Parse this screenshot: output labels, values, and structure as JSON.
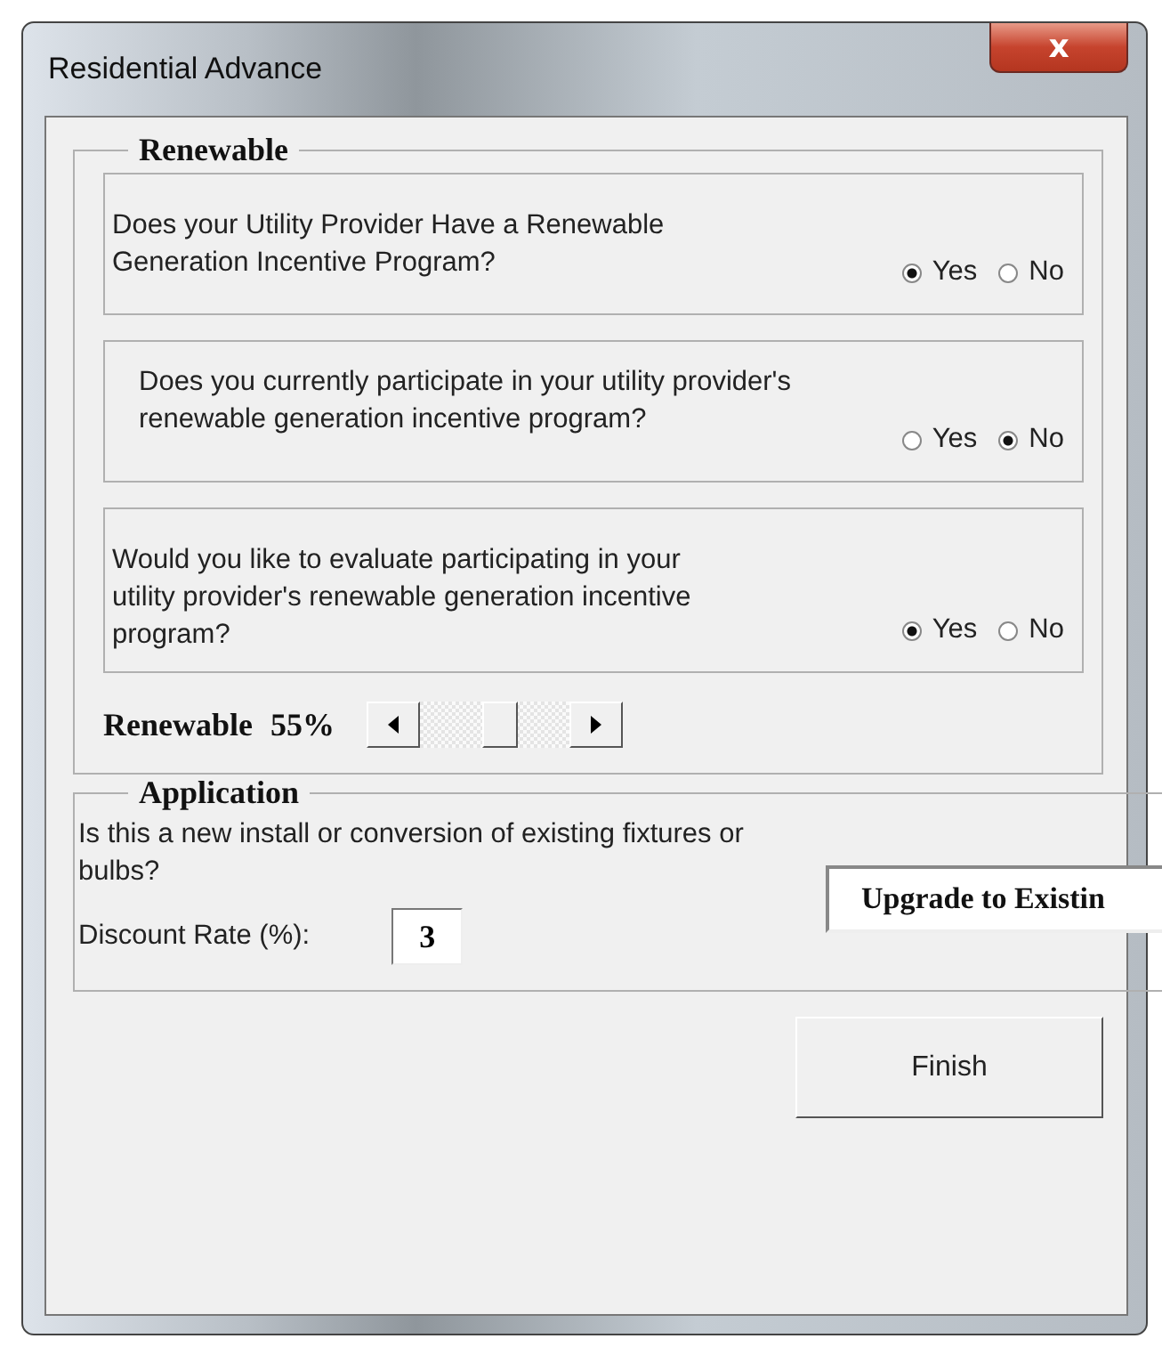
{
  "window": {
    "title": "Residential Advance",
    "close_label": "x"
  },
  "renewable": {
    "legend": "Renewable",
    "questions": [
      {
        "text": "Does your Utility Provider Have a Renewable Generation Incentive Program?",
        "options": [
          {
            "label": "Yes",
            "selected": true
          },
          {
            "label": "No",
            "selected": false
          }
        ]
      },
      {
        "text": "Does you currently participate in your utility provider's renewable generation incentive program?",
        "options": [
          {
            "label": "Yes",
            "selected": false
          },
          {
            "label": "No",
            "selected": true
          }
        ]
      },
      {
        "text": "Would you like to evaluate participating in your utility provider's renewable generation incentive program?",
        "options": [
          {
            "label": "Yes",
            "selected": true
          },
          {
            "label": "No",
            "selected": false
          }
        ]
      }
    ],
    "slider": {
      "label": "Renewable",
      "reading": "55%",
      "level": 0.55
    }
  },
  "application": {
    "legend": "Application",
    "question": "Is this a new install or conversion of existing fixtures or bulbs?",
    "dropdown": {
      "value": "Upgrade to Existin"
    },
    "discount": {
      "label": "Discount Rate (%):",
      "value": "3"
    }
  },
  "buttons": [
    "Finish"
  ]
}
